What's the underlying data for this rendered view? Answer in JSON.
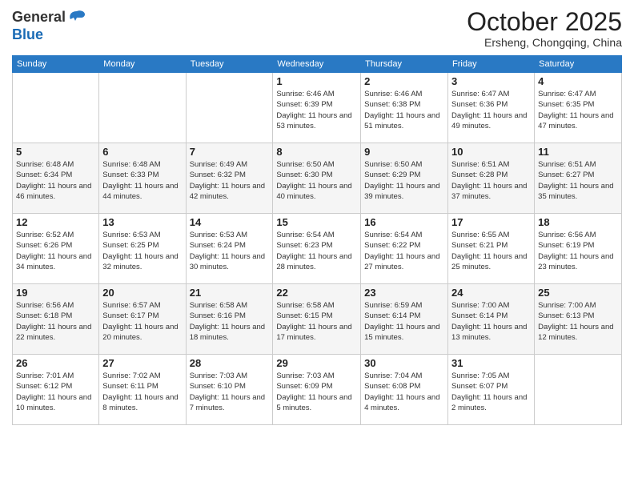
{
  "header": {
    "logo_line1": "General",
    "logo_line2": "Blue",
    "month": "October 2025",
    "location": "Ersheng, Chongqing, China"
  },
  "weekdays": [
    "Sunday",
    "Monday",
    "Tuesday",
    "Wednesday",
    "Thursday",
    "Friday",
    "Saturday"
  ],
  "weeks": [
    [
      {
        "day": "",
        "info": ""
      },
      {
        "day": "",
        "info": ""
      },
      {
        "day": "",
        "info": ""
      },
      {
        "day": "1",
        "sunrise": "6:46 AM",
        "sunset": "6:39 PM",
        "daylight": "11 hours and 53 minutes."
      },
      {
        "day": "2",
        "sunrise": "6:46 AM",
        "sunset": "6:38 PM",
        "daylight": "11 hours and 51 minutes."
      },
      {
        "day": "3",
        "sunrise": "6:47 AM",
        "sunset": "6:36 PM",
        "daylight": "11 hours and 49 minutes."
      },
      {
        "day": "4",
        "sunrise": "6:47 AM",
        "sunset": "6:35 PM",
        "daylight": "11 hours and 47 minutes."
      }
    ],
    [
      {
        "day": "5",
        "sunrise": "6:48 AM",
        "sunset": "6:34 PM",
        "daylight": "11 hours and 46 minutes."
      },
      {
        "day": "6",
        "sunrise": "6:48 AM",
        "sunset": "6:33 PM",
        "daylight": "11 hours and 44 minutes."
      },
      {
        "day": "7",
        "sunrise": "6:49 AM",
        "sunset": "6:32 PM",
        "daylight": "11 hours and 42 minutes."
      },
      {
        "day": "8",
        "sunrise": "6:50 AM",
        "sunset": "6:30 PM",
        "daylight": "11 hours and 40 minutes."
      },
      {
        "day": "9",
        "sunrise": "6:50 AM",
        "sunset": "6:29 PM",
        "daylight": "11 hours and 39 minutes."
      },
      {
        "day": "10",
        "sunrise": "6:51 AM",
        "sunset": "6:28 PM",
        "daylight": "11 hours and 37 minutes."
      },
      {
        "day": "11",
        "sunrise": "6:51 AM",
        "sunset": "6:27 PM",
        "daylight": "11 hours and 35 minutes."
      }
    ],
    [
      {
        "day": "12",
        "sunrise": "6:52 AM",
        "sunset": "6:26 PM",
        "daylight": "11 hours and 34 minutes."
      },
      {
        "day": "13",
        "sunrise": "6:53 AM",
        "sunset": "6:25 PM",
        "daylight": "11 hours and 32 minutes."
      },
      {
        "day": "14",
        "sunrise": "6:53 AM",
        "sunset": "6:24 PM",
        "daylight": "11 hours and 30 minutes."
      },
      {
        "day": "15",
        "sunrise": "6:54 AM",
        "sunset": "6:23 PM",
        "daylight": "11 hours and 28 minutes."
      },
      {
        "day": "16",
        "sunrise": "6:54 AM",
        "sunset": "6:22 PM",
        "daylight": "11 hours and 27 minutes."
      },
      {
        "day": "17",
        "sunrise": "6:55 AM",
        "sunset": "6:21 PM",
        "daylight": "11 hours and 25 minutes."
      },
      {
        "day": "18",
        "sunrise": "6:56 AM",
        "sunset": "6:19 PM",
        "daylight": "11 hours and 23 minutes."
      }
    ],
    [
      {
        "day": "19",
        "sunrise": "6:56 AM",
        "sunset": "6:18 PM",
        "daylight": "11 hours and 22 minutes."
      },
      {
        "day": "20",
        "sunrise": "6:57 AM",
        "sunset": "6:17 PM",
        "daylight": "11 hours and 20 minutes."
      },
      {
        "day": "21",
        "sunrise": "6:58 AM",
        "sunset": "6:16 PM",
        "daylight": "11 hours and 18 minutes."
      },
      {
        "day": "22",
        "sunrise": "6:58 AM",
        "sunset": "6:15 PM",
        "daylight": "11 hours and 17 minutes."
      },
      {
        "day": "23",
        "sunrise": "6:59 AM",
        "sunset": "6:14 PM",
        "daylight": "11 hours and 15 minutes."
      },
      {
        "day": "24",
        "sunrise": "7:00 AM",
        "sunset": "6:14 PM",
        "daylight": "11 hours and 13 minutes."
      },
      {
        "day": "25",
        "sunrise": "7:00 AM",
        "sunset": "6:13 PM",
        "daylight": "11 hours and 12 minutes."
      }
    ],
    [
      {
        "day": "26",
        "sunrise": "7:01 AM",
        "sunset": "6:12 PM",
        "daylight": "11 hours and 10 minutes."
      },
      {
        "day": "27",
        "sunrise": "7:02 AM",
        "sunset": "6:11 PM",
        "daylight": "11 hours and 8 minutes."
      },
      {
        "day": "28",
        "sunrise": "7:03 AM",
        "sunset": "6:10 PM",
        "daylight": "11 hours and 7 minutes."
      },
      {
        "day": "29",
        "sunrise": "7:03 AM",
        "sunset": "6:09 PM",
        "daylight": "11 hours and 5 minutes."
      },
      {
        "day": "30",
        "sunrise": "7:04 AM",
        "sunset": "6:08 PM",
        "daylight": "11 hours and 4 minutes."
      },
      {
        "day": "31",
        "sunrise": "7:05 AM",
        "sunset": "6:07 PM",
        "daylight": "11 hours and 2 minutes."
      },
      {
        "day": "",
        "info": ""
      }
    ]
  ]
}
